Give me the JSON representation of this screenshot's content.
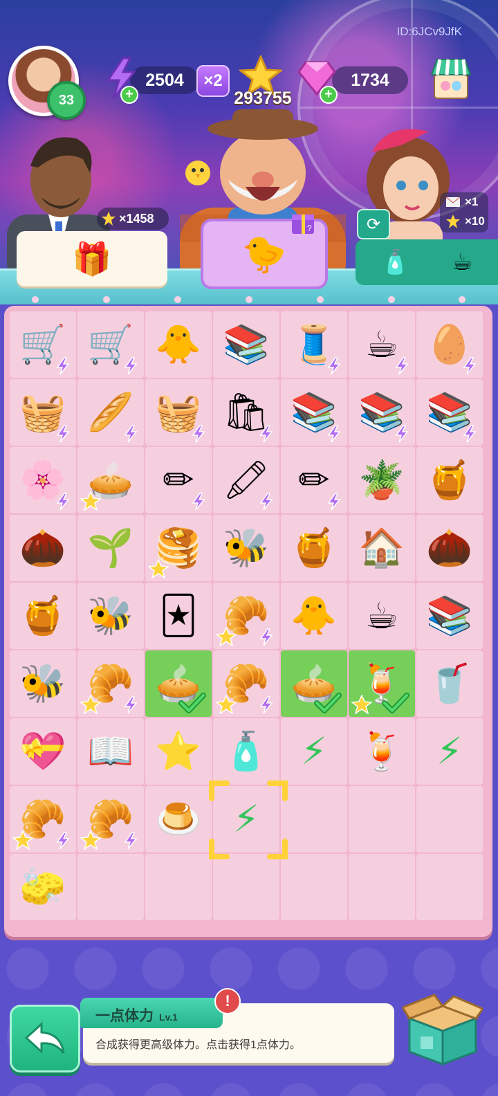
{
  "header": {
    "player_id": "ID:6JCv9JfK",
    "level": "33",
    "energy": "2504",
    "energy_multiplier": "×2",
    "stars": "293755",
    "gems": "1734"
  },
  "scene": {
    "character_star_multiplier": "×1458",
    "reward_rows": [
      {
        "icon": "envelope-icon",
        "text": "×1"
      },
      {
        "icon": "star-icon",
        "text": "×10"
      }
    ]
  },
  "board": {
    "rows": 9,
    "cols": 7,
    "cells": [
      {
        "item": "food-cart-icon",
        "glyph": "🛒",
        "bolt": true
      },
      {
        "item": "food-cart-icon",
        "glyph": "🛒",
        "bolt": true
      },
      {
        "item": "chick-icon",
        "glyph": "🐥"
      },
      {
        "item": "book-basket-icon",
        "glyph": "📚"
      },
      {
        "item": "sewing-machine-icon",
        "glyph": "🧵",
        "bolt": true
      },
      {
        "item": "coffee-mug-icon",
        "glyph": "☕",
        "bolt": true
      },
      {
        "item": "nest-eggs-icon",
        "glyph": "🥚",
        "bolt": true
      },
      {
        "item": "fruit-basket-icon",
        "glyph": "🧺",
        "bolt": true
      },
      {
        "item": "bread-basket-icon",
        "glyph": "🥖",
        "bolt": true
      },
      {
        "item": "grocery-basket-icon",
        "glyph": "🧺",
        "bolt": true
      },
      {
        "item": "shopping-bag-icon",
        "glyph": "🛍",
        "bolt": true
      },
      {
        "item": "book-cart-icon",
        "glyph": "📚",
        "bolt": true
      },
      {
        "item": "bookshelf-icon",
        "glyph": "📚",
        "bolt": true
      },
      {
        "item": "book-trolley-icon",
        "glyph": "📚",
        "bolt": true
      },
      {
        "item": "flower-pot-icon",
        "glyph": "🌸",
        "bolt": true
      },
      {
        "item": "fruit-tart-icon",
        "glyph": "🥧",
        "star": true
      },
      {
        "item": "pencil-case-icon",
        "glyph": "✏",
        "bolt": true
      },
      {
        "item": "pencil-pouch-icon",
        "glyph": "🖍",
        "bolt": true
      },
      {
        "item": "pencil-case-icon",
        "glyph": "✏",
        "bolt": true
      },
      {
        "item": "sprout-pot-icon",
        "glyph": "🪴"
      },
      {
        "item": "honeycomb-icon",
        "glyph": "🍯"
      },
      {
        "item": "seed-icon",
        "glyph": "🌰"
      },
      {
        "item": "sprout-icon",
        "glyph": "🌱"
      },
      {
        "item": "honey-pancakes-icon",
        "glyph": "🥞",
        "star": true
      },
      {
        "item": "beehive-box-icon",
        "glyph": "🐝"
      },
      {
        "item": "honey-jar-icon",
        "glyph": "🍯"
      },
      {
        "item": "beehive-house-icon",
        "glyph": "🏠"
      },
      {
        "item": "seed-icon",
        "glyph": "🌰"
      },
      {
        "item": "honeycomb-icon",
        "glyph": "🍯"
      },
      {
        "item": "beehive-icon",
        "glyph": "🐝"
      },
      {
        "item": "playing-cards-icon",
        "glyph": "🃏"
      },
      {
        "item": "croissant-box-icon",
        "glyph": "🥐",
        "star": true,
        "bolt": true
      },
      {
        "item": "chick-watermelon-icon",
        "glyph": "🐥"
      },
      {
        "item": "latte-cup-icon",
        "glyph": "☕"
      },
      {
        "item": "book-stack-icon",
        "glyph": "📚"
      },
      {
        "item": "bee-honeycomb-icon",
        "glyph": "🐝"
      },
      {
        "item": "croissant-box-icon",
        "glyph": "🥐",
        "star": true,
        "bolt": true
      },
      {
        "item": "orange-tart-icon",
        "glyph": "🥧",
        "hl": true,
        "check": true
      },
      {
        "item": "croissant-box-icon",
        "glyph": "🥐",
        "star": true,
        "bolt": true
      },
      {
        "item": "orange-tart-icon",
        "glyph": "🥧",
        "hl": true,
        "check": true
      },
      {
        "item": "fruit-drink-icon",
        "glyph": "🍹",
        "hl": true,
        "star": true,
        "check": true
      },
      {
        "item": "parfait-icon",
        "glyph": "🥤"
      },
      {
        "item": "heart-gift-box-icon",
        "glyph": "💝"
      },
      {
        "item": "popup-castle-book-icon",
        "glyph": "📖"
      },
      {
        "item": "gold-star-icon",
        "glyph": "⭐"
      },
      {
        "item": "potion-bottle-icon",
        "glyph": "🧴"
      },
      {
        "item": "green-bolts-icon",
        "glyph": "⚡"
      },
      {
        "item": "iced-drink-icon",
        "glyph": "🍹"
      },
      {
        "item": "green-bolts-icon",
        "glyph": "⚡"
      },
      {
        "item": "croissant-box-icon",
        "glyph": "🥐",
        "star": true,
        "bolt": true
      },
      {
        "item": "croissant-box-icon",
        "glyph": "🥐",
        "star": true,
        "bolt": true
      },
      {
        "item": "orange-pudding-icon",
        "glyph": "🍮"
      },
      {
        "item": "green-bolt-icon",
        "glyph": "⚡",
        "selected": true
      },
      {
        "item": "empty",
        "glyph": ""
      },
      {
        "item": "empty",
        "glyph": ""
      },
      {
        "item": "empty",
        "glyph": ""
      },
      {
        "item": "eraser-icon",
        "glyph": "🧽"
      },
      {
        "item": "empty",
        "glyph": ""
      },
      {
        "item": "empty",
        "glyph": ""
      },
      {
        "item": "empty",
        "glyph": ""
      },
      {
        "item": "empty",
        "glyph": ""
      },
      {
        "item": "empty",
        "glyph": ""
      },
      {
        "item": "empty",
        "glyph": ""
      }
    ]
  },
  "info": {
    "item_name": "一点体力",
    "item_level": "Lv.1",
    "description": "合成获得更高级体力。点击获得1点体力。",
    "alert": "!"
  },
  "colors": {
    "board_bg": "#f2b6cf",
    "cell_bg": "#f6cfdf",
    "highlight": "#75cf58",
    "accent_teal": "#25a98a"
  }
}
